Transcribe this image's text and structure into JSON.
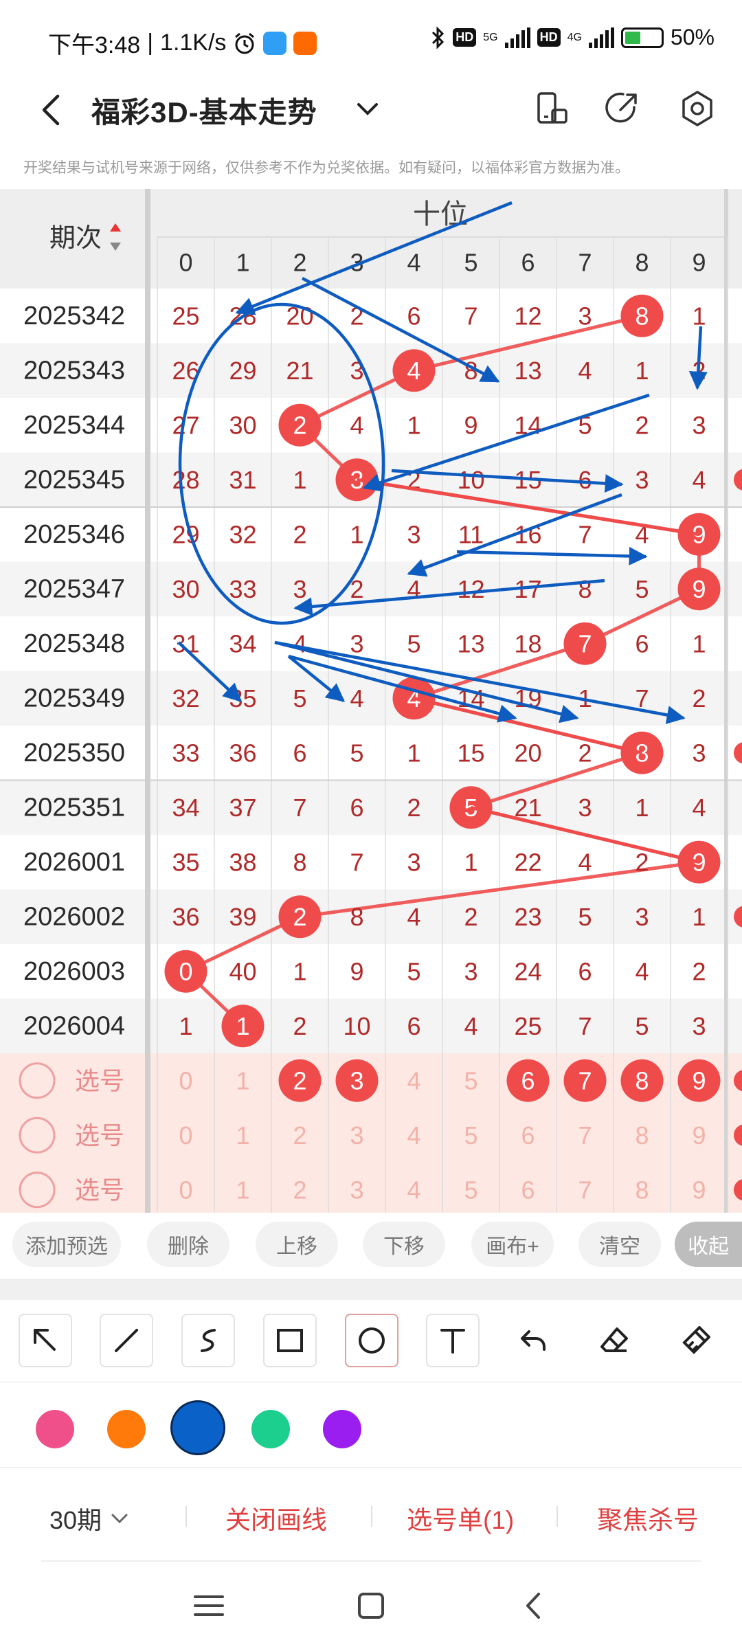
{
  "status_bar": {
    "time": "下午3:48",
    "speed": "1.1K/s",
    "alarm_icon": "alarm-icon",
    "hd1": "HD",
    "net1": "5G",
    "hd2": "HD",
    "net2": "4G",
    "battery": "50%",
    "app_colors": [
      "#2f9ef5",
      "#ff6a00"
    ]
  },
  "header": {
    "title": "福彩3D-基本走势",
    "notice": "开奖结果与试机号来源于网络，仅供参考不作为兑奖依据。如有疑问，以福体彩官方数据为准。"
  },
  "table": {
    "period_header": "期次",
    "section_header": "十位",
    "digits": [
      "0",
      "1",
      "2",
      "3",
      "4",
      "5",
      "6",
      "7",
      "8",
      "9"
    ],
    "rows": [
      {
        "period": "2025342",
        "cells": [
          "25",
          "28",
          "20",
          "2",
          "6",
          "7",
          "12",
          "3",
          "8",
          "1"
        ],
        "hit": 8
      },
      {
        "period": "2025343",
        "cells": [
          "26",
          "29",
          "21",
          "3",
          "4",
          "8",
          "13",
          "4",
          "1",
          "2"
        ],
        "hit": 4
      },
      {
        "period": "2025344",
        "cells": [
          "27",
          "30",
          "2",
          "4",
          "1",
          "9",
          "14",
          "5",
          "2",
          "3"
        ],
        "hit": 2
      },
      {
        "period": "2025345",
        "cells": [
          "28",
          "31",
          "1",
          "3",
          "2",
          "10",
          "15",
          "6",
          "3",
          "4"
        ],
        "hit": 3
      },
      {
        "period": "2025346",
        "cells": [
          "29",
          "32",
          "2",
          "1",
          "3",
          "11",
          "16",
          "7",
          "4",
          "9"
        ],
        "hit": 9
      },
      {
        "period": "2025347",
        "cells": [
          "30",
          "33",
          "3",
          "2",
          "4",
          "12",
          "17",
          "8",
          "5",
          "9"
        ],
        "hit": 9
      },
      {
        "period": "2025348",
        "cells": [
          "31",
          "34",
          "4",
          "3",
          "5",
          "13",
          "18",
          "7",
          "6",
          "1"
        ],
        "hit": 7
      },
      {
        "period": "2025349",
        "cells": [
          "32",
          "35",
          "5",
          "4",
          "4",
          "14",
          "19",
          "1",
          "7",
          "2"
        ],
        "hit": 4
      },
      {
        "period": "2025350",
        "cells": [
          "33",
          "36",
          "6",
          "5",
          "1",
          "15",
          "20",
          "2",
          "8",
          "3"
        ],
        "hit": 8
      },
      {
        "period": "2025351",
        "cells": [
          "34",
          "37",
          "7",
          "6",
          "2",
          "5",
          "21",
          "3",
          "1",
          "4"
        ],
        "hit": 5
      },
      {
        "period": "2026001",
        "cells": [
          "35",
          "38",
          "8",
          "7",
          "3",
          "1",
          "22",
          "4",
          "2",
          "9"
        ],
        "hit": 9
      },
      {
        "period": "2026002",
        "cells": [
          "36",
          "39",
          "2",
          "8",
          "4",
          "2",
          "23",
          "5",
          "3",
          "1"
        ],
        "hit": 2
      },
      {
        "period": "2026003",
        "cells": [
          "0",
          "40",
          "1",
          "9",
          "5",
          "3",
          "24",
          "6",
          "4",
          "2"
        ],
        "hit": 0
      },
      {
        "period": "2026004",
        "cells": [
          "1",
          "1",
          "2",
          "10",
          "6",
          "4",
          "25",
          "7",
          "5",
          "3"
        ],
        "hit": 1
      }
    ],
    "pick_rows": [
      {
        "label": "选号",
        "selected": [
          2,
          3,
          6,
          7,
          8,
          9
        ]
      },
      {
        "label": "选号",
        "selected": []
      },
      {
        "label": "选号",
        "selected": []
      }
    ]
  },
  "actions": {
    "add": "添加预选",
    "delete": "删除",
    "up": "上移",
    "down": "下移",
    "canvas": "画布+",
    "clear": "清空",
    "collapse": "收起"
  },
  "tools": [
    "arrow-tool-icon",
    "line-tool-icon",
    "curve-tool-icon",
    "rectangle-tool-icon",
    "circle-tool-icon",
    "text-tool-icon",
    "undo-icon",
    "eraser-icon",
    "clear-brush-icon"
  ],
  "active_tool": "circle-tool-icon",
  "palette": [
    "#f0508a",
    "#ff7a0a",
    "#0a62c9",
    "#1ccf8e",
    "#9a1ef0"
  ],
  "active_color": "#0a62c9",
  "bottom": {
    "period": "30期",
    "close_lines": "关闭画线",
    "pick_list": "选号单(1)",
    "focus": "聚焦杀号"
  },
  "colors": {
    "hit_red": "#f04b4b",
    "number_red": "#b02a2a",
    "draw_blue": "#0e5cc0",
    "pick_bg": "#fde8e4"
  }
}
